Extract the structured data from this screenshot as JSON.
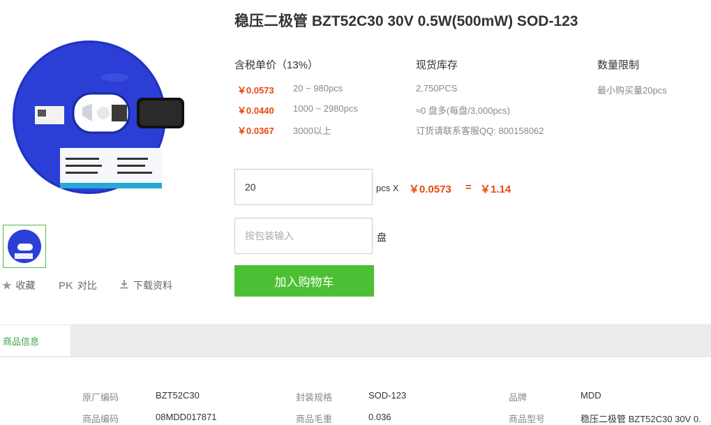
{
  "product": {
    "title": "稳压二极管 BZT52C30 30V 0.5W(500mW) SOD-123"
  },
  "pricing": {
    "header": "含税单价（13%）",
    "tiers": [
      {
        "price": "￥0.0573",
        "range": "20 ~ 980pcs"
      },
      {
        "price": "￥0.0440",
        "range": "1000 ~ 2980pcs"
      },
      {
        "price": "￥0.0367",
        "range": "3000以上"
      }
    ]
  },
  "stock": {
    "header": "现货库存",
    "lines": [
      "2,750PCS",
      "≈0 盘多(每盘/3,000pcs)",
      "订货请联系客服QQ: 800158062"
    ]
  },
  "limit": {
    "header": "数量限制",
    "text": "最小购买量20pcs"
  },
  "order": {
    "qty_value": "20",
    "unit_label": "pcs X",
    "unit_price": "￥0.0573",
    "equals": "=",
    "total": "￥1.14",
    "pkg_placeholder": "按包装输入",
    "pkg_unit": "盘",
    "cart_button": "加入购物车"
  },
  "actions": {
    "favorite": "收藏",
    "compare_icon": "PK",
    "compare": "对比",
    "download": "下载资料"
  },
  "tabs": {
    "active": "商品信息"
  },
  "specs": [
    {
      "label": "原厂编码",
      "value": "BZT52C30"
    },
    {
      "label": "封装规格",
      "value": "SOD-123"
    },
    {
      "label": "品牌",
      "value": "MDD"
    },
    {
      "label": "商品编码",
      "value": "08MDD017871"
    },
    {
      "label": "商品毛重",
      "value": "0.036"
    },
    {
      "label": "商品型号",
      "value": "稳压二极管 BZT52C30 30V 0."
    }
  ],
  "colors": {
    "accent_green": "#4cc034",
    "price_orange": "#e8480c",
    "reel_blue": "#2b3fd6"
  },
  "icons": [
    "star-icon",
    "download-icon"
  ]
}
